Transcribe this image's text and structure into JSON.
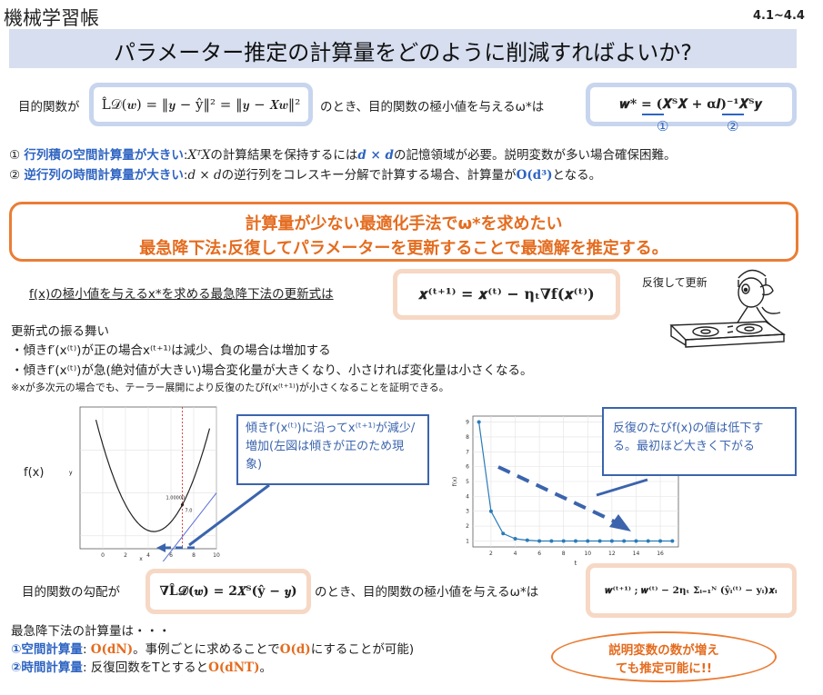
{
  "header": {
    "notebook_title": "機械学習帳",
    "pages": "4.1~4.4"
  },
  "title": "パラメーター推定の計算量をどのように削減すればよいか?",
  "objective": {
    "label": "目的関数が",
    "formula": "L̂𝒟(𝒘) = ‖𝒚 − ŷ‖² = ‖𝒚 − 𝑿𝒘‖²",
    "mid": "のとき、目的関数の極小値を与えるω*は",
    "solution": "𝒘* = (𝑿ᵀ𝑿 + α𝑰)⁻¹𝑿ᵀ𝒚",
    "marker1": "①",
    "marker2": "②"
  },
  "problems": [
    {
      "num": "①",
      "head": "行列積の空間計算量が大きい",
      "colon": ":",
      "x": "XᵀX",
      "text1": "の計算結果を保持するには",
      "dxd": "d × d",
      "text2": "の記憶領域が必要。説明変数が多い場合確保困難。"
    },
    {
      "num": "②",
      "head": "逆行列の時間計算量が大きい",
      "colon": ":",
      "dxd": "d × d",
      "text1": "の逆行列をコレスキー分解で計算する場合、計算量が",
      "order": "O(d³)",
      "text2": "となる。"
    }
  ],
  "highlight": {
    "line1": "計算量が少ない最適化手法でω*を求めたい",
    "line2": "最急降下法:反復してパラメーターを更新することで最適解を推定する。"
  },
  "update": {
    "label": "f(x)の極小値を与えるx*を求める最急降下法の更新式は",
    "formula": "𝒙⁽ᵗ⁺¹⁾ = 𝒙⁽ᵗ⁾ − ηₜ∇f(𝒙⁽ᵗ⁾)",
    "caption": "反復して更新"
  },
  "behavior": {
    "heading": "更新式の振る舞い",
    "b1": "・傾きf′(x⁽ᵗ⁾)が正の場合x⁽ᵗ⁺¹⁾は減少、負の場合は増加する",
    "b2": "・傾きf′(x⁽ᵗ⁾)が急(絶対値が大きい)場合変化量が大きくなり、小さければ変化量は小さくなる。",
    "note": "※xが多次元の場合でも、テーラー展開により反復のたびf(x⁽ᵗ⁺¹⁾)が小さくなることを証明できる。"
  },
  "chart_left_label": "f(x)",
  "callout_left": "傾きf′(x⁽ᵗ⁾)に沿ってx⁽ᵗ⁺¹⁾が減少/増加(左図は傾きが正のため現象)",
  "callout_right": "反復のたびf(x)の値は低下する。最初ほど大きく下がる",
  "chart_data": [
    {
      "type": "line",
      "title": "",
      "xlabel": "x",
      "ylabel": "y",
      "xlim": [
        -2,
        10
      ],
      "xticks": [
        0,
        2,
        4,
        6,
        8,
        10
      ],
      "series": [
        {
          "curve": "parabola",
          "x": [
            -0.5,
            0,
            2,
            4,
            4.5,
            6,
            8,
            9.5
          ],
          "y": [
            27.3,
            20.0,
            6.9,
            1.4,
            1.0,
            2.5,
            8.7,
            16.0
          ]
        },
        {
          "curve": "tangent",
          "x": [
            5,
            10
          ],
          "y": [
            -7.0,
            10.0
          ]
        }
      ],
      "annotations": [
        "1.00000",
        "7.0"
      ],
      "vline": 7.0,
      "grid": true
    },
    {
      "type": "line",
      "title": "",
      "xlabel": "t",
      "ylabel": "f(x)",
      "ylim": [
        1,
        9
      ],
      "yticks": [
        1,
        2,
        3,
        4,
        5,
        6,
        7,
        8,
        9
      ],
      "xticks": [
        2,
        4,
        6,
        8,
        10,
        12,
        14,
        16
      ],
      "series": [
        {
          "x": [
            1,
            2,
            3,
            4,
            5,
            6,
            7,
            8,
            9,
            10,
            11,
            12,
            13,
            14,
            15,
            16,
            17
          ],
          "y": [
            9.0,
            3.0,
            1.5,
            1.15,
            1.05,
            1.0,
            1.0,
            1.0,
            1.0,
            1.0,
            1.0,
            1.0,
            1.0,
            1.0,
            1.0,
            1.0,
            1.0
          ]
        }
      ],
      "grid": true
    }
  ],
  "gradient": {
    "label": "目的関数の勾配が",
    "formula": "∇L̂𝒟(𝒘) = 2𝑿ᵀ(ŷ − 𝒚)",
    "mid": "のとき、目的関数の極小値を与えるω*は",
    "update": "𝒘⁽ᵗ⁺¹⁾ ; 𝒘⁽ᵗ⁾ − 2ηₜ Σᵢ₌₁ᴺ (ŷᵢ⁽ᵗ⁾ − yᵢ)𝒙ᵢ"
  },
  "cost": {
    "heading": "最急降下法の計算量は・・・",
    "l1_head": "①空間計算量",
    "l1_sep": ": ",
    "l1_order": "O(dN)",
    "l1_text1": "。事例ごとに求めることで",
    "l1_order2": "O(d)",
    "l1_text2": "にすることが可能)",
    "l2_head": "②時間計算量",
    "l2_sep": ": ",
    "l2_text1": "反復回数をTとすると",
    "l2_order": "O(dNT)",
    "l2_text2": "。"
  },
  "ellipse": {
    "line1": "説明変数の数が増え",
    "line2": "ても推定可能に!!"
  }
}
